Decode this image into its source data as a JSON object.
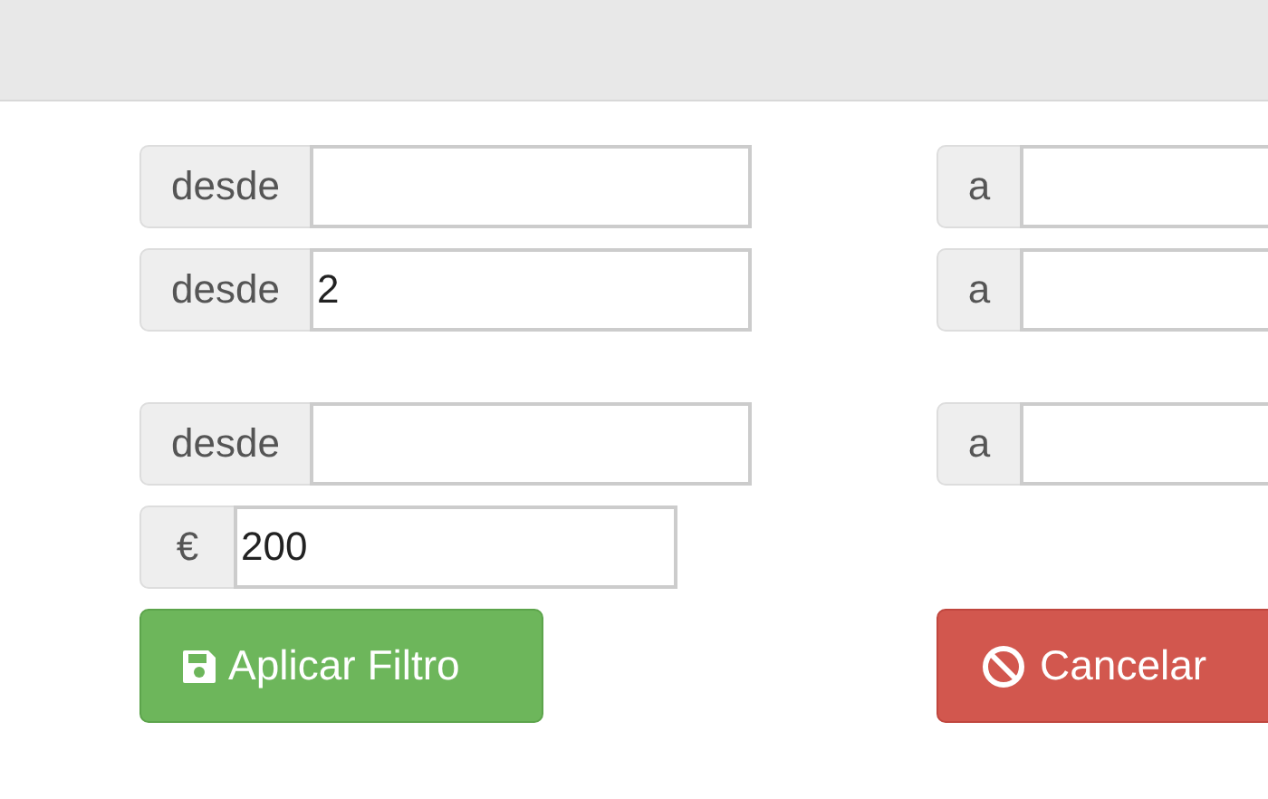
{
  "ranges": [
    {
      "from": {
        "label": "desde"
      },
      "to": {
        "label": "a"
      }
    },
    {
      "from": {
        "label": "desde",
        "value": "2"
      },
      "to": {
        "label": "a"
      }
    },
    {
      "from": {
        "label": "desde"
      },
      "to": {
        "label": "a"
      }
    }
  ],
  "price": {
    "label": "€",
    "value": "200"
  },
  "buttons": [
    {
      "kind": "apply",
      "label": "Aplicar Filtro"
    },
    {
      "kind": "cancel",
      "label": "Cancelar"
    }
  ]
}
